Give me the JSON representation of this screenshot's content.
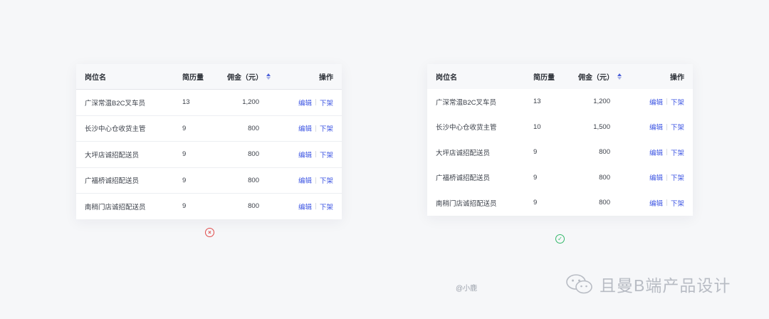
{
  "tables": {
    "left": {
      "headers": {
        "name": "岗位名",
        "count": "简历量",
        "pay": "佣金（元）",
        "ops": "操作"
      },
      "rows": [
        {
          "name": "广深常温B2C叉车员",
          "count": "13",
          "pay": "1,200",
          "edit": "编辑",
          "remove": "下架"
        },
        {
          "name": "长沙中心仓收货主管",
          "count": "9",
          "pay": "800",
          "edit": "编辑",
          "remove": "下架"
        },
        {
          "name": "大坪店诚招配送员",
          "count": "9",
          "pay": "800",
          "edit": "编辑",
          "remove": "下架"
        },
        {
          "name": "广福桥诚招配送员",
          "count": "9",
          "pay": "800",
          "edit": "编辑",
          "remove": "下架"
        },
        {
          "name": "南稍门店诚招配送员",
          "count": "9",
          "pay": "800",
          "edit": "编辑",
          "remove": "下架"
        }
      ]
    },
    "right": {
      "headers": {
        "name": "岗位名",
        "count": "简历量",
        "pay": "佣金（元）",
        "ops": "操作"
      },
      "rows": [
        {
          "name": "广深常温B2C叉车员",
          "count": "13",
          "pay": "1,200",
          "edit": "编辑",
          "remove": "下架"
        },
        {
          "name": "长沙中心仓收货主管",
          "count": "10",
          "pay": "1,500",
          "edit": "编辑",
          "remove": "下架"
        },
        {
          "name": "大坪店诚招配送员",
          "count": "9",
          "pay": "800",
          "edit": "编辑",
          "remove": "下架"
        },
        {
          "name": "广福桥诚招配送员",
          "count": "9",
          "pay": "800",
          "edit": "编辑",
          "remove": "下架"
        },
        {
          "name": "南稍门店诚招配送员",
          "count": "9",
          "pay": "800",
          "edit": "编辑",
          "remove": "下架"
        }
      ]
    }
  },
  "status": {
    "wrong": {
      "icon": "close-circle-icon",
      "glyph": "×",
      "color": "#e04a4a"
    },
    "correct": {
      "icon": "check-circle-icon",
      "glyph": "✓",
      "color": "#33b86a"
    }
  },
  "credit": "@小鹿",
  "watermark": {
    "icon": "wechat-icon",
    "text": "且曼B端产品设计"
  },
  "colors": {
    "link": "#3f57e3",
    "background": "#f6f7f9"
  }
}
